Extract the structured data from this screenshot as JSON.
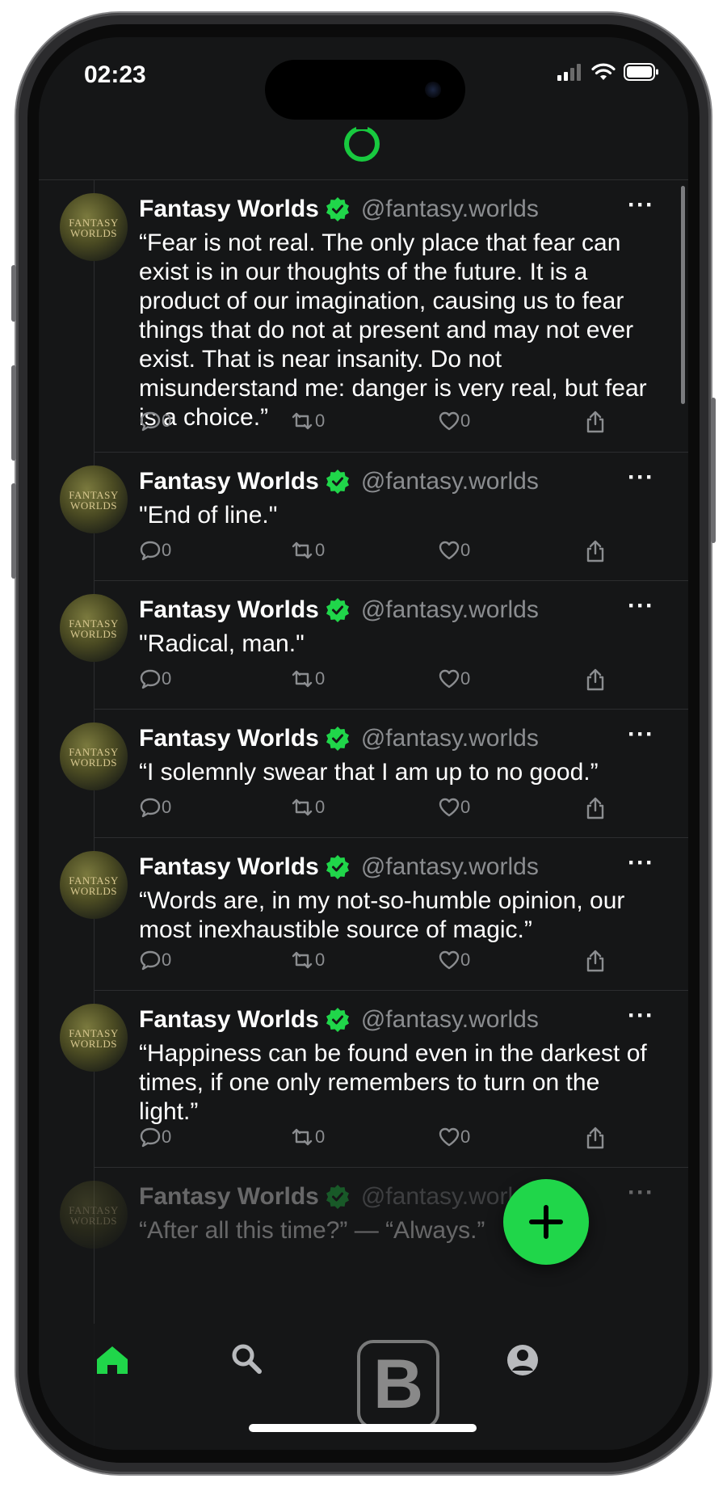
{
  "status_bar": {
    "time": "02:23"
  },
  "colors": {
    "accent": "#20d64a",
    "background": "#151617",
    "muted_text": "#8b8d90"
  },
  "app": {
    "logo_icon": "ring-logo-icon"
  },
  "post_defaults": {
    "author": "Fantasy Worlds",
    "handle": "@fantasy.worlds",
    "avatar_text_line1": "FANTASY",
    "avatar_text_line2": "WORLDS",
    "more_label": "···"
  },
  "posts": [
    {
      "text": "“Fear is not real. The only place that fear can exist is in our thoughts of the future. It is a product of our imagination, causing us to fear things that do not at present and may not ever exist. That is near insanity. Do not misunderstand me: danger is very real, but fear is a choice.”",
      "replies": "0",
      "reposts": "0",
      "likes": "0"
    },
    {
      "text": "\"End of line.\"",
      "replies": "0",
      "reposts": "0",
      "likes": "0"
    },
    {
      "text": "\"Radical, man.\"",
      "replies": "0",
      "reposts": "0",
      "likes": "0"
    },
    {
      "text": "“I solemnly swear that I am up to no good.”",
      "replies": "0",
      "reposts": "0",
      "likes": "0"
    },
    {
      "text": "“Words are, in my not-so-humble opinion, our most inexhaustible source of magic.”",
      "replies": "0",
      "reposts": "0",
      "likes": "0"
    },
    {
      "text": "“Happiness can be found even in the darkest of times, if one only remembers to turn on the light.”",
      "replies": "0",
      "reposts": "0",
      "likes": "0"
    },
    {
      "text": "“After all this time?” — “Always.”",
      "replies": "",
      "reposts": "",
      "likes": ""
    }
  ],
  "tabbar": {
    "items": [
      "home-icon",
      "search-icon",
      "profile-icon"
    ]
  },
  "fab": {
    "icon": "plus-icon"
  },
  "watermark": {
    "letter": "B"
  }
}
